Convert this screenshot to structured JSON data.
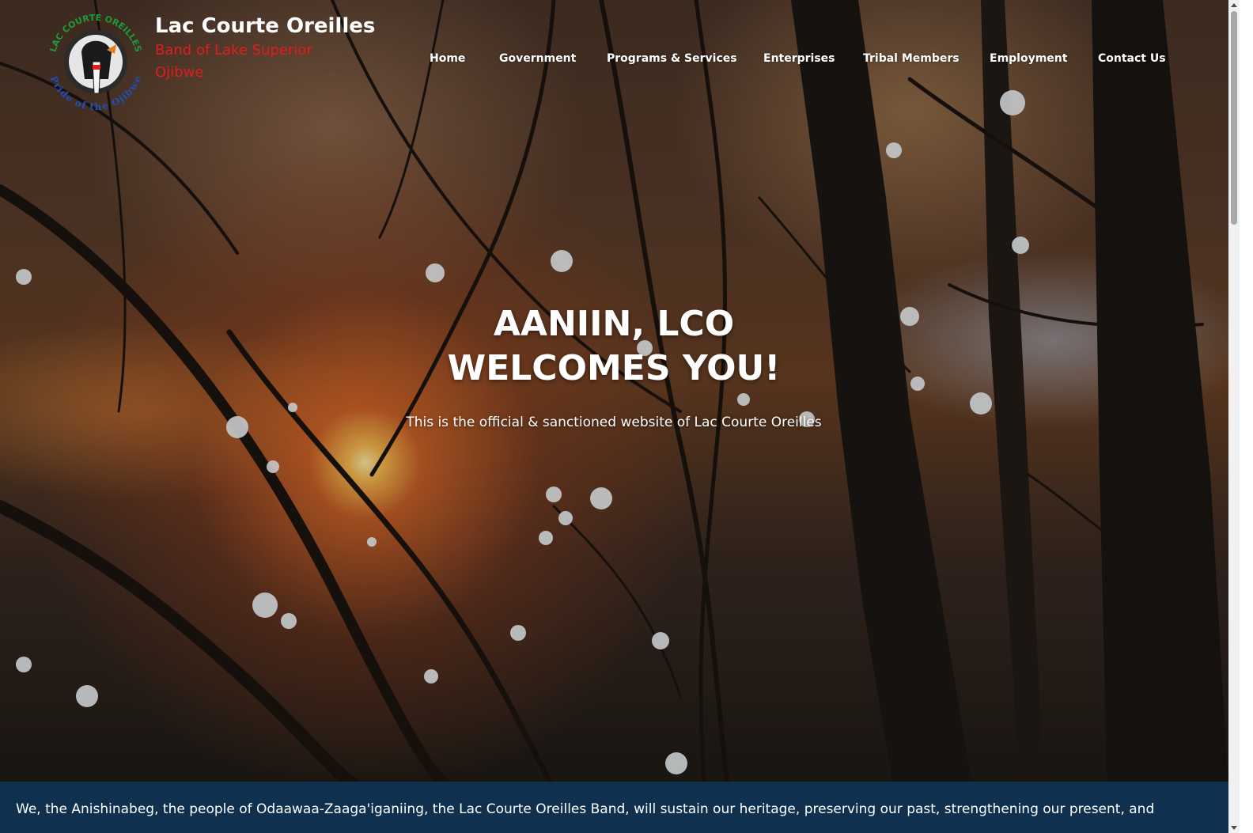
{
  "site": {
    "title": "Lac Courte Oreilles",
    "subtitle": "Band of Lake Superior Ojibwe",
    "logo": {
      "top_text": "LAC COURTE OREILLES",
      "bottom_text": "Pride of the Ojibwe"
    }
  },
  "nav": {
    "items": [
      {
        "label": "Home"
      },
      {
        "label": "Government"
      },
      {
        "label": "Programs & Services"
      },
      {
        "label": "Enterprises"
      },
      {
        "label": "Tribal Members"
      },
      {
        "label": "Employment"
      },
      {
        "label": "Contact Us"
      }
    ]
  },
  "hero": {
    "heading_line1": "AANIIN, LCO",
    "heading_line2": "WELCOMES YOU!",
    "tagline": "This is the official & sanctioned website of Lac Courte Oreilles"
  },
  "mission": {
    "text": "We, the Anishinabeg, the people of Odaawaa-Zaaga'iganiing, the Lac Courte Oreilles Band, will sustain our heritage, preserving our past, strengthening our present, and"
  },
  "colors": {
    "subtitle": "#e11d1d",
    "banner": "#10304f",
    "logo_green": "#1e9a3a",
    "logo_blue": "#1f4fb8"
  }
}
